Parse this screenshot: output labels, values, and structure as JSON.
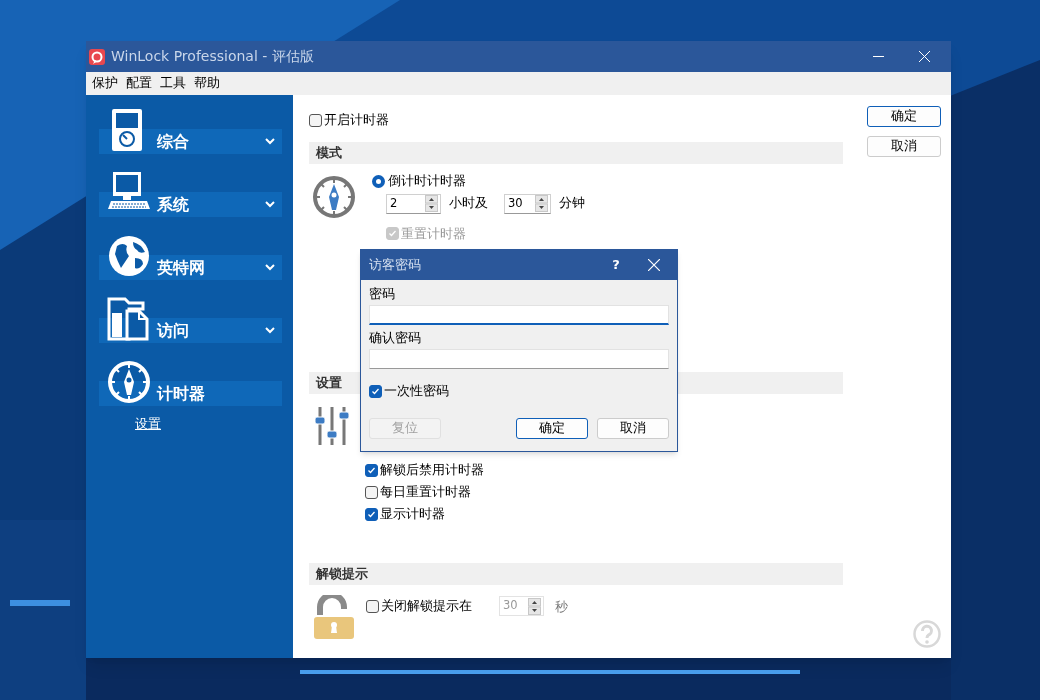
{
  "window": {
    "title": "WinLock Professional - 评估版"
  },
  "menu": [
    "保护",
    "配置",
    "工具",
    "帮助"
  ],
  "sidebar": {
    "items": [
      {
        "label": "综合",
        "kind": "player",
        "expanded": false
      },
      {
        "label": "系统",
        "kind": "monitor",
        "expanded": false
      },
      {
        "label": "英特网",
        "kind": "globe",
        "expanded": false
      },
      {
        "label": "访问",
        "kind": "files",
        "expanded": false
      },
      {
        "label": "计时器",
        "kind": "compass",
        "expanded": true,
        "children": [
          {
            "label": "设置"
          }
        ]
      }
    ]
  },
  "content": {
    "enable_timer": {
      "label": "开启计时器",
      "checked": false
    },
    "mode": {
      "title": "模式",
      "countdown": {
        "label": "倒计时计时器",
        "selected": true
      },
      "hours": {
        "value": "2",
        "unit": "小时及"
      },
      "minutes": {
        "value": "30",
        "unit": "分钟"
      },
      "reset": {
        "label": "重置计时器",
        "checked": true,
        "disabled": true
      }
    },
    "settings": {
      "title": "设置",
      "options": [
        {
          "label": "解锁后禁用计时器",
          "checked": true
        },
        {
          "label": "每日重置计时器",
          "checked": false
        },
        {
          "label": "显示计时器",
          "checked": true
        }
      ]
    },
    "unlock_hint": {
      "title": "解锁提示",
      "option": {
        "label": "关闭解锁提示在",
        "checked": false
      },
      "seconds": {
        "value": "30",
        "unit": "秒",
        "disabled": true
      }
    }
  },
  "buttons": [
    {
      "label": "确定",
      "default": true
    },
    {
      "label": "取消",
      "default": false
    }
  ],
  "dialog": {
    "title": "访客密码",
    "help": "?",
    "fields": [
      {
        "label": "密码",
        "focused": true
      },
      {
        "label": "确认密码",
        "focused": false
      }
    ],
    "one_time": {
      "label": "一次性密码",
      "checked": true
    },
    "buttons": [
      {
        "label": "复位",
        "disabled": true,
        "default": false
      },
      {
        "label": "确定",
        "disabled": false,
        "default": true
      },
      {
        "label": "取消",
        "disabled": false,
        "default": false
      }
    ]
  }
}
